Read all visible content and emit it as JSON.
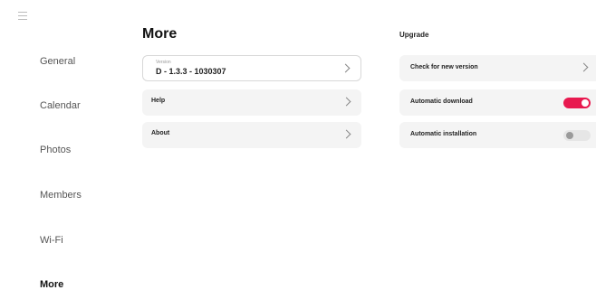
{
  "sidebar": {
    "items": [
      {
        "label": "General"
      },
      {
        "label": "Calendar"
      },
      {
        "label": "Photos"
      },
      {
        "label": "Members"
      },
      {
        "label": "Wi-Fi"
      },
      {
        "label": "More",
        "active": true
      }
    ]
  },
  "main": {
    "title": "More",
    "version": {
      "caption": "Version",
      "value": "D - 1.3.3 - 1030307"
    },
    "help_label": "Help",
    "about_label": "About"
  },
  "upgrade": {
    "title": "Upgrade",
    "check_label": "Check for new version",
    "auto_download_label": "Automatic download",
    "auto_download_enabled": true,
    "auto_install_label": "Automatic installation",
    "auto_install_enabled": false
  },
  "colors": {
    "accent": "#e8194f",
    "card_bg": "#f4f4f4"
  }
}
